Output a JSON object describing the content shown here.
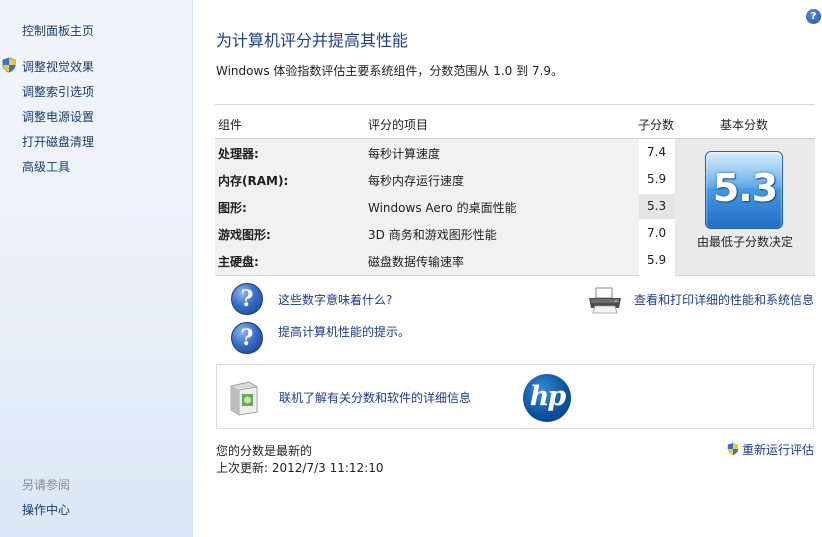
{
  "sidebar": {
    "home": "控制面板主页",
    "items": [
      {
        "label": "调整视觉效果"
      },
      {
        "label": "调整索引选项"
      },
      {
        "label": "调整电源设置"
      },
      {
        "label": "打开磁盘清理"
      },
      {
        "label": "高级工具"
      }
    ],
    "see_also_title": "另请参阅",
    "see_also_items": [
      {
        "label": "操作中心"
      }
    ]
  },
  "help": {
    "symbol": "?"
  },
  "main": {
    "title": "为计算机评分并提高其性能",
    "subtitle": "Windows 体验指数评估主要系统组件，分数范围从 1.0 到 7.9。"
  },
  "table": {
    "headers": {
      "component": "组件",
      "item": "评分的项目",
      "subscore": "子分数",
      "base": "基本分数"
    },
    "rows": [
      {
        "component": "处理器:",
        "item": "每秒计算速度",
        "score": "7.4"
      },
      {
        "component": "内存(RAM):",
        "item": "每秒内存运行速度",
        "score": "5.9"
      },
      {
        "component": "图形:",
        "item": "Windows Aero 的桌面性能",
        "score": "5.3"
      },
      {
        "component": "游戏图形:",
        "item": "3D 商务和游戏图形性能",
        "score": "7.0"
      },
      {
        "component": "主硬盘:",
        "item": "磁盘数据传输速率",
        "score": "5.9"
      }
    ],
    "base_score": "5.3",
    "base_note": "由最低子分数决定"
  },
  "links": {
    "what_numbers_mean": "这些数字意味着什么?",
    "tips": "提高计算机性能的提示。",
    "print_details": "查看和打印详细的性能和系统信息",
    "online_info": "联机了解有关分数和软件的详细信息"
  },
  "hp": {
    "logo_text": "hp"
  },
  "status": {
    "current": "您的分数是最新的",
    "last_update": "上次更新: 2012/7/3 11:12:10",
    "rerun": "重新运行评估"
  },
  "colors": {
    "link": "#1b3b8e",
    "title": "#1e3f8a",
    "badge": "#1f6ec6"
  }
}
